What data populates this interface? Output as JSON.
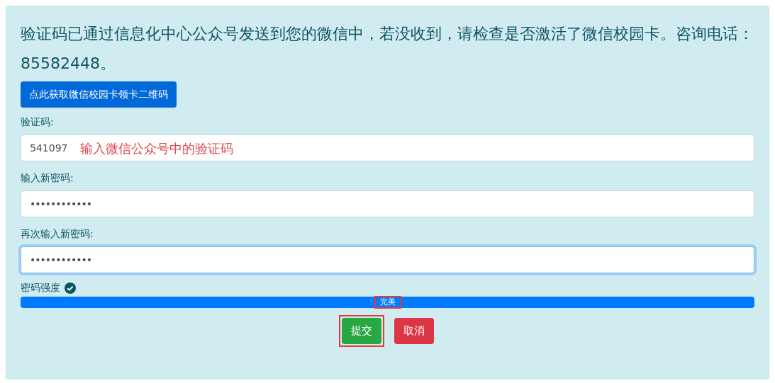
{
  "notice": "验证码已通过信息化中心公众号发送到您的微信中，若没收到，请检查是否激活了微信校园卡。咨询电话：85582448。",
  "qr_button": "点此获取微信校园卡领卡二维码",
  "fields": [
    {
      "label": "验证码:",
      "value": "541097",
      "kind": "text",
      "focused": false,
      "annotation": "输入微信公众号中的验证码"
    },
    {
      "label": "输入新密码:",
      "value": "••••••••••••",
      "kind": "password",
      "focused": false
    },
    {
      "label": "再次输入新密码:",
      "value": "••••••••••••",
      "kind": "password",
      "focused": true
    }
  ],
  "strength": {
    "label": "密码强度",
    "valid": true,
    "reading": "完美",
    "highlighted": true
  },
  "buttons": [
    {
      "label": "提交",
      "kind": "submit",
      "highlighted": true
    },
    {
      "label": "取消",
      "kind": "cancel",
      "highlighted": false
    }
  ]
}
